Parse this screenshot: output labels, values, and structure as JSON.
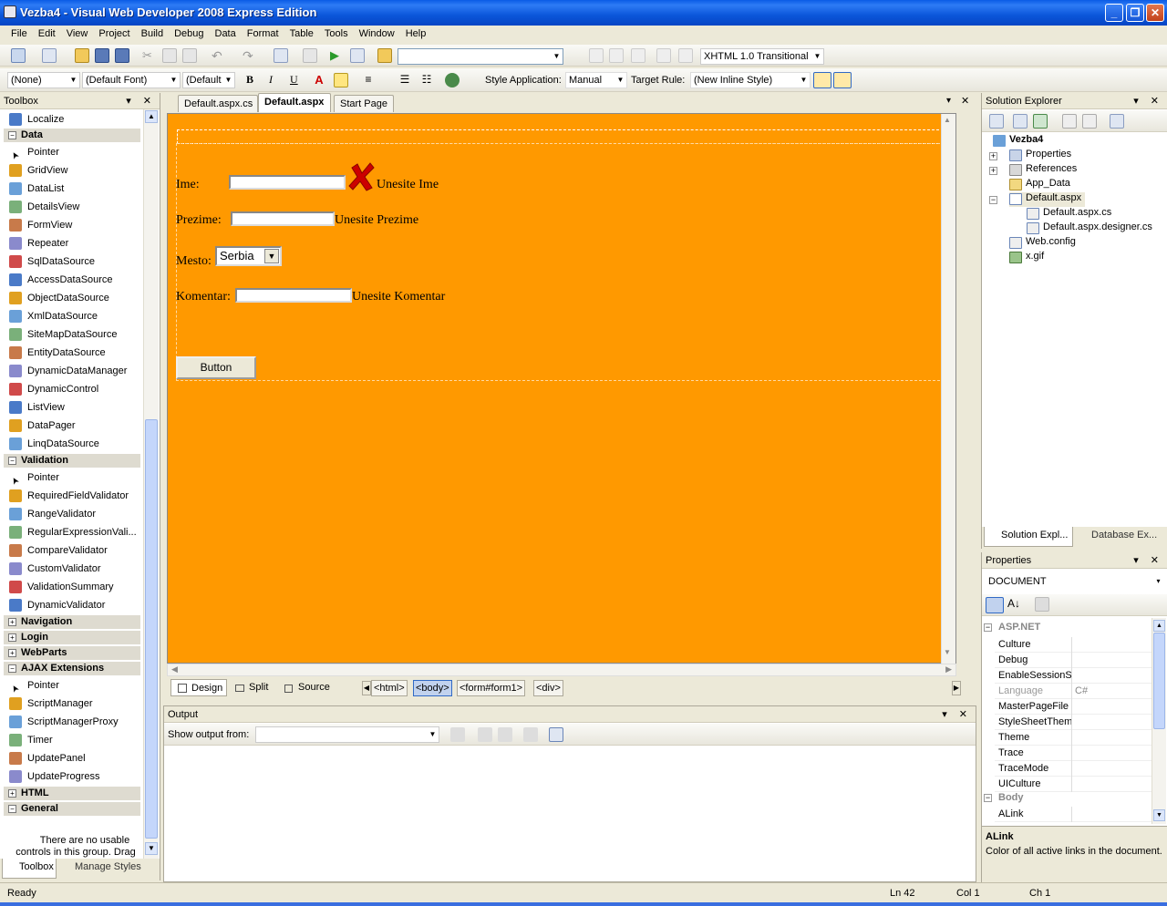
{
  "window": {
    "title": "Vezba4 - Visual Web Developer 2008 Express Edition"
  },
  "menu": [
    "File",
    "Edit",
    "View",
    "Project",
    "Build",
    "Debug",
    "Data",
    "Format",
    "Table",
    "Tools",
    "Window",
    "Help"
  ],
  "toolbar1": {
    "doctype": "XHTML 1.0 Transitional ("
  },
  "toolbar2": {
    "block_format": "(None)",
    "font": "(Default Font)",
    "size": "(Default",
    "bold": "B",
    "italic": "I",
    "underline": "U",
    "style_app_label": "Style Application:",
    "style_app_value": "Manual",
    "target_rule_label": "Target Rule:",
    "target_rule_value": "(New Inline Style)"
  },
  "toolbox": {
    "title": "Toolbox",
    "top_item": "Localize",
    "categories": {
      "data": "Data",
      "validation": "Validation",
      "navigation": "Navigation",
      "login": "Login",
      "webparts": "WebParts",
      "ajax": "AJAX Extensions",
      "html": "HTML",
      "general": "General"
    },
    "data_items": [
      "Pointer",
      "GridView",
      "DataList",
      "DetailsView",
      "FormView",
      "Repeater",
      "SqlDataSource",
      "AccessDataSource",
      "ObjectDataSource",
      "XmlDataSource",
      "SiteMapDataSource",
      "EntityDataSource",
      "DynamicDataManager",
      "DynamicControl",
      "ListView",
      "DataPager",
      "LinqDataSource"
    ],
    "validation_items": [
      "Pointer",
      "RequiredFieldValidator",
      "RangeValidator",
      "RegularExpressionVali...",
      "CompareValidator",
      "CustomValidator",
      "ValidationSummary",
      "DynamicValidator"
    ],
    "ajax_items": [
      "Pointer",
      "ScriptManager",
      "ScriptManagerProxy",
      "Timer",
      "UpdatePanel",
      "UpdateProgress"
    ],
    "general_text_1": "There are no usable",
    "general_text_2": "controls in this group. Drag",
    "bottom_tabs": [
      "Toolbox",
      "Manage Styles"
    ]
  },
  "editor": {
    "tabs": [
      "Default.aspx.cs",
      "Default.aspx",
      "Start Page"
    ],
    "form": {
      "ime_label": "Ime:",
      "ime_error": "Unesite Ime",
      "prezime_label": "Prezime:",
      "prezime_error": "Unesite Prezime",
      "mesto_label": "Mesto:",
      "mesto_value": "Serbia",
      "komentar_label": "Komentar:",
      "komentar_error": "Unesite Komentar",
      "button_label": "Button"
    },
    "view_tabs": [
      "Design",
      "Split",
      "Source"
    ],
    "tag_path": [
      "<html>",
      "<body>",
      "<form#form1>",
      "<div>"
    ]
  },
  "output": {
    "title": "Output",
    "show_from_label": "Show output from:"
  },
  "solution_explorer": {
    "title": "Solution Explorer",
    "items": [
      "Vezba4",
      "Properties",
      "References",
      "App_Data",
      "Default.aspx",
      "Default.aspx.cs",
      "Default.aspx.designer.cs",
      "Web.config",
      "x.gif"
    ],
    "bottom_tabs": [
      "Solution Expl...",
      "Database Ex..."
    ]
  },
  "properties": {
    "title": "Properties",
    "object": "DOCUMENT",
    "cat_aspnet": "ASP.NET",
    "rows": [
      {
        "name": "Culture",
        "value": ""
      },
      {
        "name": "Debug",
        "value": ""
      },
      {
        "name": "EnableSessionSt",
        "value": ""
      },
      {
        "name": "Language",
        "value": "C#"
      },
      {
        "name": "MasterPageFile",
        "value": ""
      },
      {
        "name": "StyleSheetThem",
        "value": ""
      },
      {
        "name": "Theme",
        "value": ""
      },
      {
        "name": "Trace",
        "value": ""
      },
      {
        "name": "TraceMode",
        "value": ""
      },
      {
        "name": "UICulture",
        "value": ""
      }
    ],
    "cat_body": "Body",
    "body_row": "ALink",
    "desc_title": "ALink",
    "desc_text": "Color of all active links in the document."
  },
  "status": {
    "ready": "Ready",
    "ln": "Ln 42",
    "col": "Col 1",
    "ch": "Ch 1"
  },
  "colors": {
    "canvas": "#FF9900",
    "titlebar": "#0A5BE6",
    "validator": "#CC0000"
  }
}
